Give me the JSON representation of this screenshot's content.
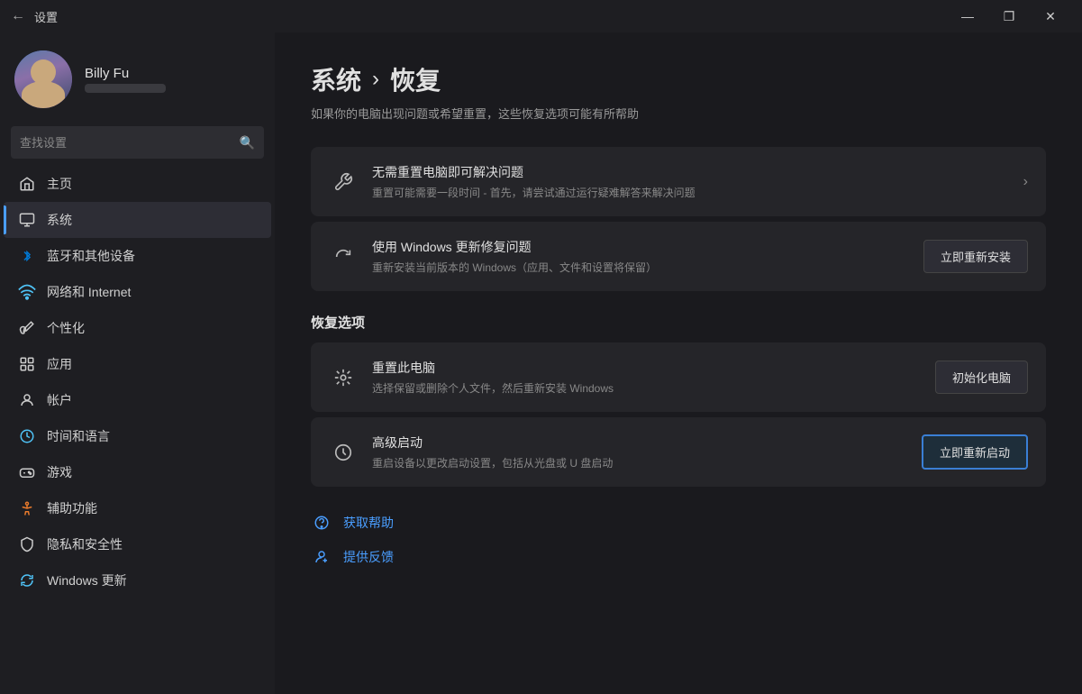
{
  "titlebar": {
    "back_label": "←",
    "title": "设置",
    "min_label": "—",
    "max_label": "❐",
    "close_label": "✕"
  },
  "sidebar": {
    "user": {
      "name": "Billy Fu",
      "sub": ""
    },
    "search_placeholder": "查找设置",
    "nav_items": [
      {
        "id": "home",
        "label": "主页",
        "icon": "home"
      },
      {
        "id": "system",
        "label": "系统",
        "icon": "system",
        "active": true
      },
      {
        "id": "bluetooth",
        "label": "蓝牙和其他设备",
        "icon": "bluetooth"
      },
      {
        "id": "network",
        "label": "网络和 Internet",
        "icon": "wifi"
      },
      {
        "id": "personalization",
        "label": "个性化",
        "icon": "brush"
      },
      {
        "id": "apps",
        "label": "应用",
        "icon": "apps"
      },
      {
        "id": "accounts",
        "label": "帐户",
        "icon": "user"
      },
      {
        "id": "time",
        "label": "时间和语言",
        "icon": "clock"
      },
      {
        "id": "gaming",
        "label": "游戏",
        "icon": "game"
      },
      {
        "id": "accessibility",
        "label": "辅助功能",
        "icon": "access"
      },
      {
        "id": "privacy",
        "label": "隐私和安全性",
        "icon": "shield"
      },
      {
        "id": "update",
        "label": "Windows 更新",
        "icon": "update"
      }
    ]
  },
  "content": {
    "breadcrumb_parent": "系统",
    "breadcrumb_sep": "›",
    "breadcrumb_current": "恢复",
    "description": "如果你的电脑出现问题或希望重置，这些恢复选项可能有所帮助",
    "cards": [
      {
        "id": "troubleshoot",
        "title": "无需重置电脑即可解决问题",
        "desc": "重置可能需要一段时间 - 首先，请尝试通过运行疑难解答来解决问题",
        "action_type": "chevron",
        "action_label": "›"
      },
      {
        "id": "reinstall",
        "title": "使用 Windows 更新修复问题",
        "desc": "重新安装当前版本的 Windows（应用、文件和设置将保留）",
        "action_type": "button",
        "action_label": "立即重新安装"
      }
    ],
    "section_title": "恢复选项",
    "recovery_items": [
      {
        "id": "reset",
        "title": "重置此电脑",
        "desc": "选择保留或删除个人文件，然后重新安装 Windows",
        "action_label": "初始化电脑"
      },
      {
        "id": "advanced",
        "title": "高级启动",
        "desc": "重启设备以更改启动设置，包括从光盘或 U 盘启动",
        "action_label": "立即重新启动",
        "highlighted": true
      }
    ],
    "footer_links": [
      {
        "id": "help",
        "label": "获取帮助",
        "icon": "help"
      },
      {
        "id": "feedback",
        "label": "提供反馈",
        "icon": "feedback"
      }
    ]
  }
}
